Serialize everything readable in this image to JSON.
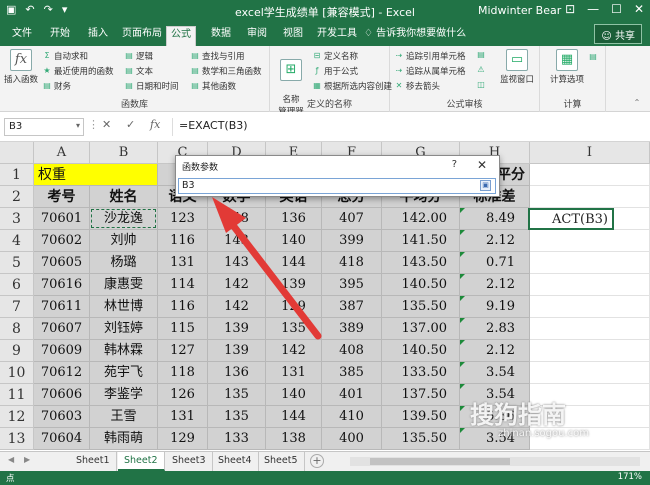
{
  "titlebar": {
    "title": "excel学生成绩单 [兼容模式] - Excel",
    "user": "Midwinter Bear",
    "qat": [
      "save-icon",
      "undo-icon",
      "redo-icon",
      "customize-icon"
    ]
  },
  "tabs": [
    "文件",
    "开始",
    "插入",
    "页面布局",
    "公式",
    "数据",
    "审阅",
    "视图",
    "开发工具"
  ],
  "active_tab": "公式",
  "tell_me": "告诉我你想要做什么",
  "share_label": "共享",
  "ribbon": {
    "fn_lib": {
      "insert_fn": "插入函数",
      "autosum": "自动求和",
      "recent": "最近使用的函数",
      "financial": "财务",
      "logical": "逻辑",
      "text": "文本",
      "datetime": "日期和时间",
      "lookup": "查找与引用",
      "math": "数学和三角函数",
      "more": "其他函数",
      "group_label": "函数库"
    },
    "names": {
      "name_mgr": "名称\n管理器",
      "define": "定义名称",
      "use_in": "用于公式",
      "create": "根据所选内容创建",
      "group_label": "定义的名称"
    },
    "audit": {
      "trace_prec": "追踪引用单元格",
      "trace_dep": "追踪从属单元格",
      "remove": "移去箭头",
      "watch": "监视窗口",
      "group_label": "公式审核"
    },
    "calc": {
      "options": "计算选项",
      "group_label": "计算"
    }
  },
  "formula_bar": {
    "name_box": "B3",
    "formula": "=EXACT(B3)"
  },
  "columns": [
    "A",
    "B",
    "C",
    "D",
    "E",
    "F",
    "G",
    "H",
    "I"
  ],
  "rows": [
    "1",
    "2",
    "3",
    "4",
    "5",
    "6",
    "7",
    "8",
    "9",
    "10",
    "11",
    "12",
    "13"
  ],
  "row1": {
    "weight": "权重",
    "h_partial": "平分"
  },
  "headers": [
    "考号",
    "姓名",
    "语文",
    "数学",
    "英语",
    "总分",
    "平均分",
    "标准差"
  ],
  "table": [
    [
      "70601",
      "沙龙逸",
      "123",
      "148",
      "136",
      "407",
      "142.00",
      "8.49"
    ],
    [
      "70602",
      "刘帅",
      "116",
      "143",
      "140",
      "399",
      "141.50",
      "2.12"
    ],
    [
      "70605",
      "杨璐",
      "131",
      "143",
      "144",
      "418",
      "143.50",
      "0.71"
    ],
    [
      "70616",
      "康惠雯",
      "114",
      "142",
      "139",
      "395",
      "140.50",
      "2.12"
    ],
    [
      "70611",
      "林世博",
      "116",
      "142",
      "129",
      "387",
      "135.50",
      "9.19"
    ],
    [
      "70607",
      "刘钰婷",
      "115",
      "139",
      "135",
      "389",
      "137.00",
      "2.83"
    ],
    [
      "70609",
      "韩林霖",
      "127",
      "139",
      "142",
      "408",
      "140.50",
      "2.12"
    ],
    [
      "70612",
      "苑宇飞",
      "118",
      "136",
      "131",
      "385",
      "133.50",
      "3.54"
    ],
    [
      "70606",
      "李鉴学",
      "126",
      "135",
      "140",
      "401",
      "137.50",
      "3.54"
    ],
    [
      "70603",
      "王雪",
      "131",
      "135",
      "144",
      "410",
      "139.50",
      "6.36"
    ],
    [
      "70604",
      "韩雨萌",
      "129",
      "133",
      "138",
      "400",
      "135.50",
      "3.54"
    ]
  ],
  "i3_text": "ACT(B3)",
  "dialog": {
    "title": "函数参数",
    "help": "?",
    "close": "✕",
    "input_value": "B3"
  },
  "sheets": [
    "Sheet1",
    "Sheet2",
    "Sheet3",
    "Sheet4",
    "Sheet5"
  ],
  "active_sheet": "Sheet2",
  "status": {
    "mode": "点",
    "zoom": "171%"
  },
  "watermark": {
    "main": "搜狗指南",
    "sub": "zhinan.sogou.com"
  },
  "colors": {
    "accent": "#217346",
    "arrow": "#e23a36",
    "highlight": "#ffff00"
  }
}
